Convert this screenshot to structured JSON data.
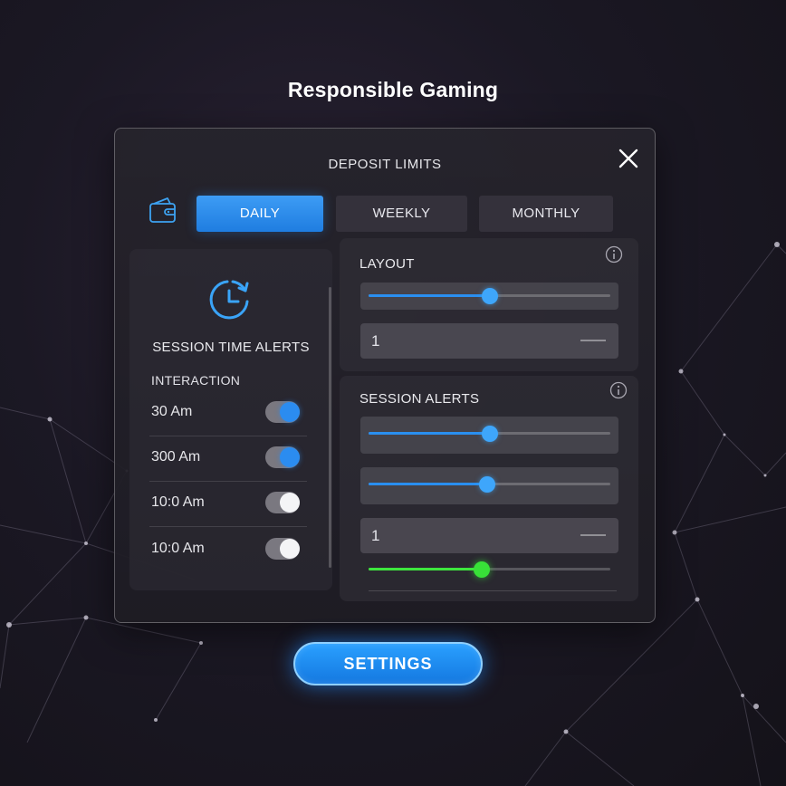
{
  "page": {
    "title": "Responsible Gaming"
  },
  "modal": {
    "title": "DEPOSIT LIMITS",
    "tabs": [
      {
        "label": "DAILY",
        "active": true
      },
      {
        "label": "WEEKLY",
        "active": false
      },
      {
        "label": "MONTHLY",
        "active": false
      }
    ]
  },
  "session_time_alerts": {
    "title": "SESSION TIME ALERTS",
    "subtitle": "INTERACTION",
    "items": [
      {
        "label": "30 Am",
        "enabled": true
      },
      {
        "label": "300 Am",
        "enabled": true
      },
      {
        "label": "10:0 Am",
        "enabled": false
      },
      {
        "label": "10:0 Am",
        "enabled": false
      }
    ]
  },
  "layout_card": {
    "title": "LAYOUT",
    "slider_level": 0.5,
    "number_value": "1"
  },
  "session_alerts_card": {
    "title": "SESSION ALERTS",
    "slider_levels": [
      0.5,
      0.49
    ],
    "number_value": "1",
    "green_slider_level": 0.47
  },
  "settings_button": {
    "label": "SETTINGS"
  },
  "colors": {
    "accent_blue": "#2a8ff0",
    "accent_green": "#3ee63e",
    "panel_bg": "#26242c"
  },
  "icons": [
    "wallet-icon",
    "close-icon",
    "clock-icon",
    "info-icon"
  ]
}
